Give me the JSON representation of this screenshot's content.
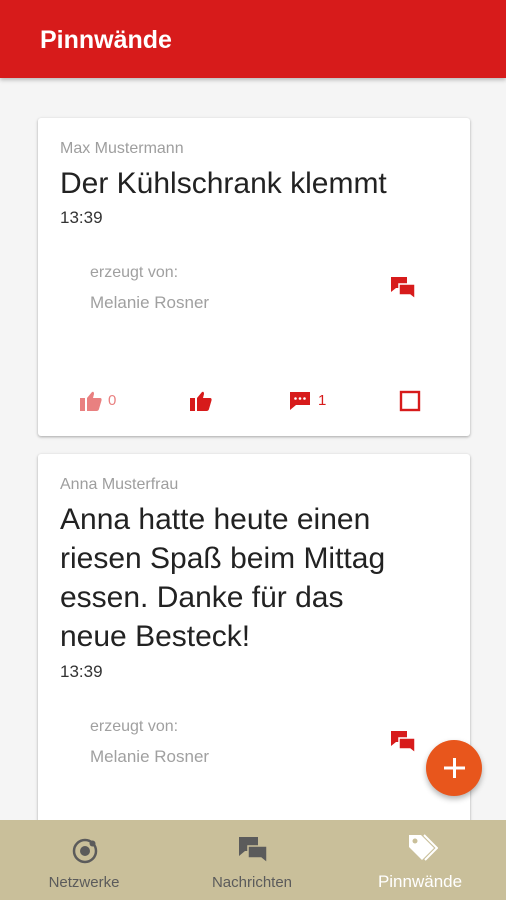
{
  "appbar": {
    "title": "Pinnwände"
  },
  "posts": [
    {
      "author": "Max Mustermann",
      "title": "Der Kühlschrank klemmt",
      "time": "13:39",
      "created_by_label": "erzeugt von:",
      "created_by_name": "Melanie Rosner",
      "likes": "0",
      "comments": "1"
    },
    {
      "author": "Anna Musterfrau",
      "title_lines": [
        "Anna hatte heute einen",
        "riesen Spaß beim Mittag",
        "essen. Danke für das",
        "neue Besteck!"
      ],
      "time": "13:39",
      "created_by_label": "erzeugt von:",
      "created_by_name": "Melanie Rosner"
    }
  ],
  "bottom_nav": [
    {
      "label": "Netzwerke",
      "icon": "network-icon"
    },
    {
      "label": "Nachrichten",
      "icon": "chat-icon"
    },
    {
      "label": "Pinnwände",
      "icon": "tag-icon",
      "active": true
    }
  ],
  "fab": {
    "icon": "plus-icon"
  },
  "colors": {
    "primary": "#d71b1b",
    "accent": "#e8561c",
    "nav_bg": "#c9bf9a"
  }
}
